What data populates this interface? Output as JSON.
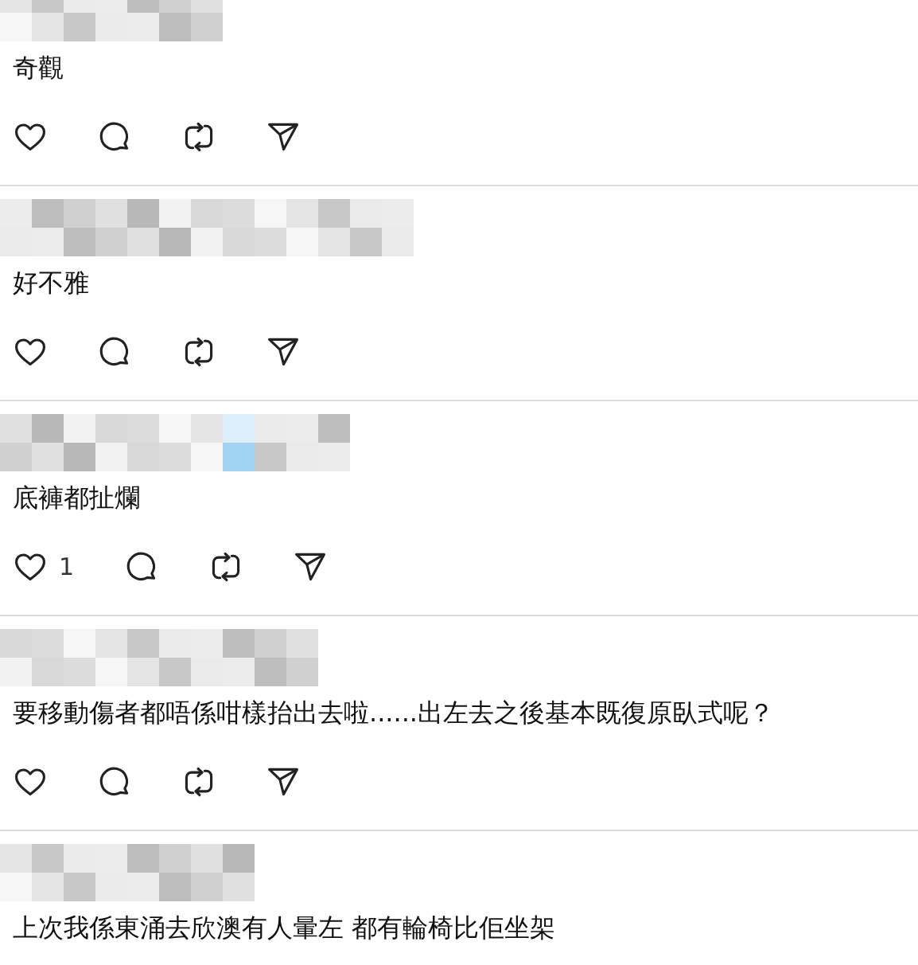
{
  "comments": [
    {
      "text": "奇觀"
    },
    {
      "text": "好不雅"
    },
    {
      "text": "底褲都扯爛",
      "like_count": "1"
    },
    {
      "text": "要移動傷者都唔係咁樣抬出去啦......出左去之後基本既復原臥式呢？"
    },
    {
      "text": "上次我係東涌去欣澳有人暈左 都有輪椅比佢坐架"
    }
  ]
}
